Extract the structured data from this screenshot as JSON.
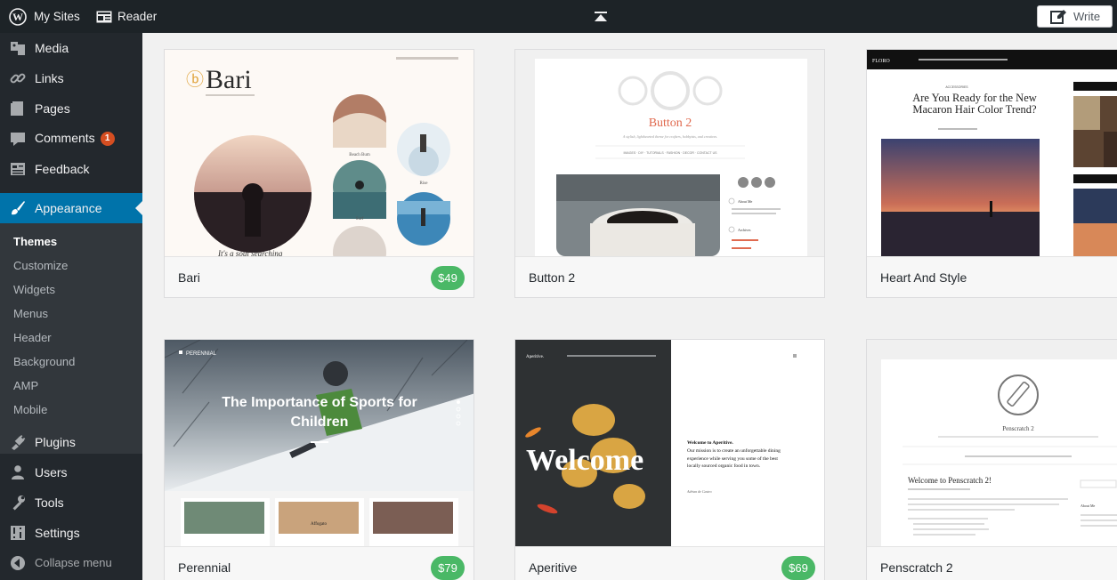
{
  "topbar": {
    "my_sites": "My Sites",
    "reader": "Reader",
    "write": "Write"
  },
  "sidebar": {
    "items": [
      {
        "label": "Media",
        "icon": "media-icon"
      },
      {
        "label": "Links",
        "icon": "link-icon"
      },
      {
        "label": "Pages",
        "icon": "pages-icon"
      },
      {
        "label": "Comments",
        "icon": "comment-icon",
        "badge": "1"
      },
      {
        "label": "Feedback",
        "icon": "feedback-icon"
      },
      {
        "label": "Appearance",
        "icon": "brush-icon"
      },
      {
        "label": "Plugins",
        "icon": "plugin-icon"
      },
      {
        "label": "Users",
        "icon": "users-icon"
      },
      {
        "label": "Tools",
        "icon": "wrench-icon"
      },
      {
        "label": "Settings",
        "icon": "settings-icon"
      },
      {
        "label": "Collapse menu",
        "icon": "collapse-icon"
      }
    ],
    "submenu": [
      "Themes",
      "Customize",
      "Widgets",
      "Menus",
      "Header",
      "Background",
      "AMP",
      "Mobile"
    ]
  },
  "themes": [
    {
      "name": "Bari",
      "price": "$49",
      "preview": {
        "title": "Bari",
        "captions": [
          "Beach Bum",
          "Rise",
          "Surf"
        ],
        "footer_text": "It's a soul searching"
      }
    },
    {
      "name": "Button 2",
      "price": "",
      "preview": {
        "title": "Button 2",
        "tagline": "A stylish, lighthearted theme for crafters, hobbyists, and creatives.",
        "nav": "IMAGES · DIY · TUTORIALS · FASHION · DECOR · CONTACT US",
        "widgets": [
          "About Me",
          "Archives"
        ]
      }
    },
    {
      "name": "Heart And Style",
      "price": "",
      "preview": {
        "logo": "FLORO",
        "category": "ACCESSORIES",
        "headline": "Are You Ready for the New Macaron Hair Color Trend?"
      }
    },
    {
      "name": "Perennial",
      "price": "$79",
      "preview": {
        "logo": "PERENNIAL",
        "headline": "The Importance of Sports for Children",
        "sub_caption": "Affogato"
      }
    },
    {
      "name": "Aperitive",
      "price": "$69",
      "preview": {
        "logo": "Aperitive.",
        "hero": "Welcome",
        "intro_title": "Welcome to Aperitive.",
        "intro_text": "Our mission is to create an unforgettable dining experience while serving you some of the best locally sourced organic food in town.",
        "signature": "Adrian de Castro"
      }
    },
    {
      "name": "Penscratch 2",
      "price": "",
      "preview": {
        "site_title": "Penscratch 2",
        "post_title": "Welcome to Penscratch 2!",
        "widget_title": "About Me"
      }
    }
  ],
  "colors": {
    "admin_bar": "#1d2327",
    "sidebar": "#23282d",
    "submenu": "#32373c",
    "active": "#0073aa",
    "badge": "#d54e21",
    "price": "#4ab866"
  }
}
